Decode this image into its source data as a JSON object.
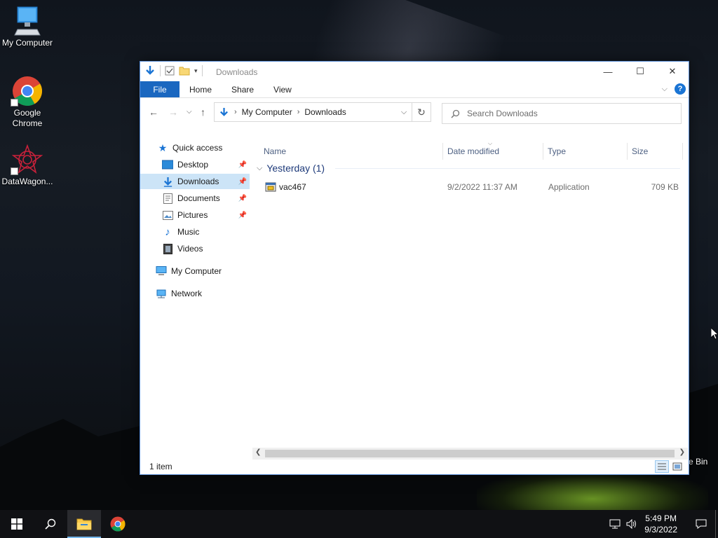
{
  "desktop": {
    "icons": [
      {
        "label": "My Computer",
        "icon": "computer-icon"
      },
      {
        "label": "Google Chrome",
        "icon": "chrome-icon"
      },
      {
        "label": "DataWagon...",
        "icon": "datawagon-icon"
      }
    ],
    "recycle_bin_label": "e Bin"
  },
  "window": {
    "title": "Downloads",
    "controls": {
      "minimize": "—",
      "maximize": "☐",
      "close": "✕"
    }
  },
  "ribbon": {
    "tabs": [
      {
        "label": "File"
      },
      {
        "label": "Home"
      },
      {
        "label": "Share"
      },
      {
        "label": "View"
      }
    ],
    "help": "?"
  },
  "address": {
    "crumbs": [
      "My Computer",
      "Downloads"
    ]
  },
  "search": {
    "placeholder": "Search Downloads"
  },
  "nav_pane": {
    "quick_access": "Quick access",
    "items": [
      {
        "label": "Desktop",
        "pinned": true
      },
      {
        "label": "Downloads",
        "pinned": true,
        "selected": true
      },
      {
        "label": "Documents",
        "pinned": true
      },
      {
        "label": "Pictures",
        "pinned": true
      },
      {
        "label": "Music",
        "pinned": false
      },
      {
        "label": "Videos",
        "pinned": false
      }
    ],
    "my_computer": "My Computer",
    "network": "Network"
  },
  "columns": {
    "name": "Name",
    "date_modified": "Date modified",
    "type": "Type",
    "size": "Size"
  },
  "group": {
    "label": "Yesterday (1)"
  },
  "files": [
    {
      "name": "vac467",
      "date": "9/2/2022 11:37 AM",
      "type": "Application",
      "size": "709 KB"
    }
  ],
  "status": {
    "count": "1 item"
  },
  "taskbar": {
    "time": "5:49 PM",
    "date": "9/3/2022"
  }
}
